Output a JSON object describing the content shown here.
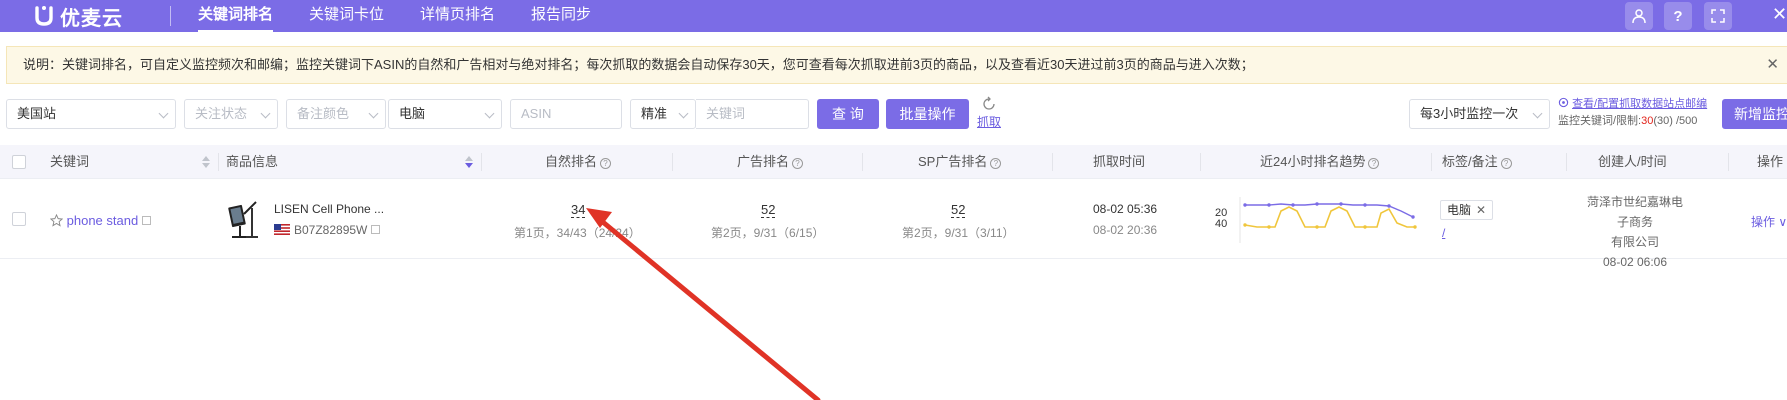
{
  "app": {
    "name": "优麦云"
  },
  "nav": {
    "items": [
      "关键词排名",
      "关键词卡位",
      "详情页排名",
      "报告同步"
    ]
  },
  "notice": {
    "text": "说明：关键词排名，可自定义监控频次和邮编；监控关键词下ASIN的自然和广告相对与绝对排名；每次抓取的数据会自动保存30天，您可查看每次抓取进前3页的商品，以及查看近30天进过前3页的商品与进入次数；"
  },
  "filters": {
    "site": "美国站",
    "follow_status": "关注状态",
    "note_color": "备注颜色",
    "device": "电脑",
    "asin_placeholder": "ASIN",
    "match": "精准",
    "keyword_placeholder": "关键词",
    "query_btn": "查 询",
    "batch_btn": "批量操作",
    "fetch_label": "抓取",
    "frequency": "每3小时监控一次",
    "config_link": "查看/配置抓取数据站点邮编",
    "limit_label": "监控关键词/限制:",
    "limit_used": "30",
    "limit_rest": "(30) /500",
    "add_btn": "新增监控"
  },
  "table": {
    "columns": [
      "关键词",
      "商品信息",
      "自然排名",
      "广告排名",
      "SP广告排名",
      "抓取时间",
      "近24小时排名趋势",
      "标签/备注",
      "创建人/时间",
      "操作"
    ],
    "rows": [
      {
        "keyword": "phone stand",
        "product_title": "LISEN Cell Phone ...",
        "asin": "B07Z82895W",
        "organic_rank": "34",
        "organic_detail": "第1页，34/43（24/24）",
        "ad_rank": "52",
        "ad_detail": "第2页，9/31（6/15）",
        "sp_rank": "52",
        "sp_detail": "第2页，9/31（3/11）",
        "fetch_time_1": "08-02 05:36",
        "fetch_time_2": "08-02 20:36",
        "trend_label_top": "20",
        "trend_label_bottom": "40",
        "tag": "电脑",
        "tag_edit": "/",
        "creator_line1": "菏泽市世纪嘉琳电子商务",
        "creator_line2": "有限公司",
        "created_time": "08-02 06:06",
        "action": "操作"
      }
    ]
  },
  "colors": {
    "brand": "#7b6ce6",
    "link": "#6b5ce0",
    "arrow": "#e03326",
    "trend_purple": "#7b6ce6",
    "trend_yellow": "#f0c63c"
  }
}
